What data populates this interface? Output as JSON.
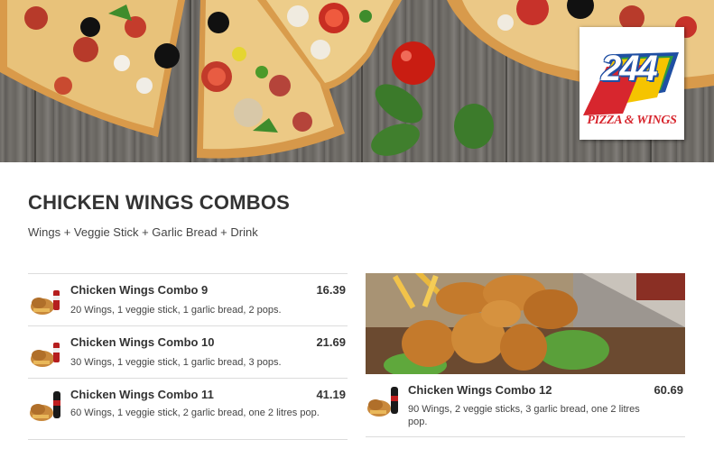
{
  "brand": {
    "logo_number": "244",
    "logo_text": "PIZZA & WINGS"
  },
  "section": {
    "title": "CHICKEN WINGS COMBOS",
    "subtitle": "Wings + Veggie Stick + Garlic Bread + Drink"
  },
  "items": [
    {
      "name": "Chicken Wings Combo 9",
      "price": "16.39",
      "description": "20 Wings, 1 veggie stick, 1 garlic bread, 2 pops."
    },
    {
      "name": "Chicken Wings Combo 10",
      "price": "21.69",
      "description": "30 Wings, 1 veggie stick, 1 garlic bread, 3 pops."
    },
    {
      "name": "Chicken Wings Combo 11",
      "price": "41.19",
      "description": "60 Wings, 1 veggie stick, 2 garlic bread, one 2 litres pop."
    },
    {
      "name": "Chicken Wings Combo 12",
      "price": "60.69",
      "description": "90 Wings, 2 veggie sticks, 3 garlic bread, one 2 litres pop."
    }
  ],
  "icons": {
    "combo_thumbnail": "combo-thumbnail-icon",
    "banner": "pizza-banner-image",
    "feature_photo": "chicken-wings-photo"
  },
  "colors": {
    "text": "#333333",
    "divider": "#dcdcdc",
    "logo_red": "#d7262e",
    "logo_yellow": "#f5c400",
    "logo_blue": "#1f4fa3",
    "logo_green": "#2e9a3e"
  }
}
